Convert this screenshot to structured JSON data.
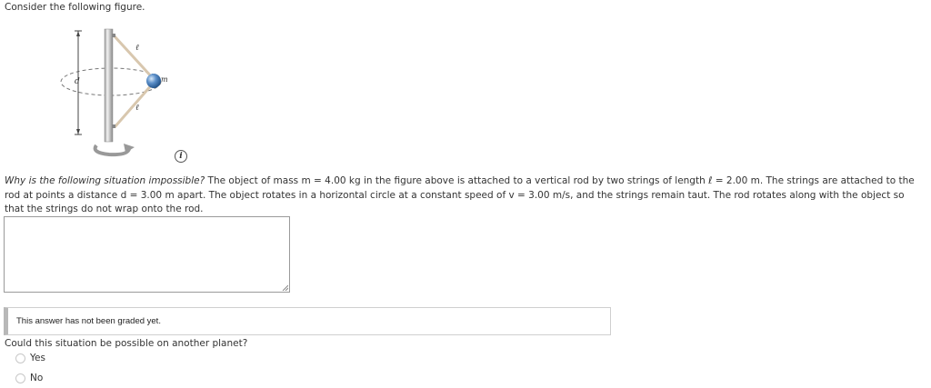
{
  "intro": "Consider the following figure.",
  "figure": {
    "label_l_top": "ℓ",
    "label_l_bottom": "ℓ",
    "label_d": "d",
    "label_m": "m"
  },
  "info_icon": "i",
  "problem": {
    "lead": "Why is the following situation impossible?",
    "text": " The object of mass m = 4.00 kg in the figure above is attached to a vertical rod by two strings of length ℓ = 2.00 m. The strings are attached to the rod at points a distance d = 3.00 m apart. The object rotates in a horizontal circle at a constant speed of v = 3.00 m/s, and the strings remain taut. The rod rotates along with the object so that the strings do not wrap onto the rod."
  },
  "answer": {
    "value": ""
  },
  "grading_status": "This answer has not been graded yet.",
  "question2": "Could this situation be possible on another planet?",
  "options": [
    "Yes",
    "No"
  ]
}
